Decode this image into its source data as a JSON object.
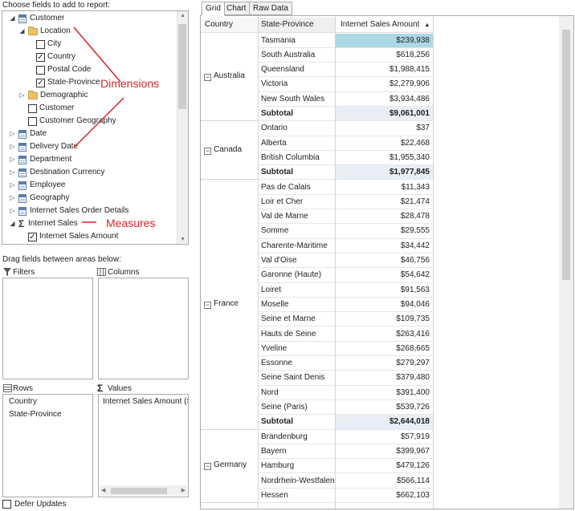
{
  "field_list": {
    "heading": "Choose fields to add to report:",
    "items": [
      {
        "label": "Customer",
        "kind": "table",
        "expander": "expanded",
        "level": 0
      },
      {
        "label": "Location",
        "kind": "folder",
        "expander": "expanded",
        "level": 1
      },
      {
        "label": "City",
        "kind": "field",
        "checked": false,
        "level": 2
      },
      {
        "label": "Country",
        "kind": "field",
        "checked": true,
        "level": 2
      },
      {
        "label": "Postal Code",
        "kind": "field",
        "checked": false,
        "level": 2
      },
      {
        "label": "State-Province",
        "kind": "field",
        "checked": true,
        "level": 2
      },
      {
        "label": "Demographic",
        "kind": "folder",
        "expander": "collapsed",
        "level": 1
      },
      {
        "label": "Customer",
        "kind": "field",
        "checked": false,
        "level": 1
      },
      {
        "label": "Customer Geography",
        "kind": "field",
        "checked": false,
        "level": 1
      },
      {
        "label": "Date",
        "kind": "table",
        "expander": "collapsed",
        "level": 0
      },
      {
        "label": "Delivery Date",
        "kind": "table",
        "expander": "collapsed",
        "level": 0
      },
      {
        "label": "Department",
        "kind": "table",
        "expander": "collapsed",
        "level": 0
      },
      {
        "label": "Destination Currency",
        "kind": "table",
        "expander": "collapsed",
        "level": 0
      },
      {
        "label": "Employee",
        "kind": "table",
        "expander": "collapsed",
        "level": 0
      },
      {
        "label": "Geography",
        "kind": "table",
        "expander": "collapsed",
        "level": 0
      },
      {
        "label": "Internet Sales Order Details",
        "kind": "table",
        "expander": "collapsed",
        "level": 0
      },
      {
        "label": "Internet Sales",
        "kind": "measure-group",
        "expander": "expanded",
        "level": 0
      },
      {
        "label": "Internet Sales Amount",
        "kind": "field",
        "checked": true,
        "level": 1
      }
    ]
  },
  "annotations": {
    "dimensions": "Dimensions",
    "measures": "Measures"
  },
  "areas": {
    "heading": "Drag fields between areas below:",
    "filters_label": "Filters",
    "columns_label": "Columns",
    "rows_label": "Rows",
    "values_label": "Values",
    "rows_items": [
      "Country",
      "State-Province"
    ],
    "values_items": [
      "Internet Sales Amount (S"
    ]
  },
  "defer_updates": {
    "label": "Defer Updates",
    "checked": false
  },
  "tabs": [
    {
      "label": "Grid",
      "active": true
    },
    {
      "label": "Chart",
      "active": false
    },
    {
      "label": "Raw Data",
      "active": false
    }
  ],
  "grid": {
    "headers": {
      "country": "Country",
      "state": "State-Province",
      "amount": "Internet Sales Amount",
      "sort_glyph": "▲"
    },
    "subtotal_label": "Subtotal",
    "groups": [
      {
        "country": "Australia",
        "rows": [
          {
            "state": "Tasmania",
            "amount": "$239,938",
            "highlight": true
          },
          {
            "state": "South Australia",
            "amount": "$618,256"
          },
          {
            "state": "Queensland",
            "amount": "$1,988,415"
          },
          {
            "state": "Victoria",
            "amount": "$2,279,906"
          },
          {
            "state": "New South Wales",
            "amount": "$3,934,486"
          }
        ],
        "subtotal": "$9,061,001"
      },
      {
        "country": "Canada",
        "rows": [
          {
            "state": "Ontario",
            "amount": "$37"
          },
          {
            "state": "Alberta",
            "amount": "$22,468"
          },
          {
            "state": "British Columbia",
            "amount": "$1,955,340"
          }
        ],
        "subtotal": "$1,977,845"
      },
      {
        "country": "France",
        "rows": [
          {
            "state": "Pas de Calais",
            "amount": "$11,343"
          },
          {
            "state": "Loir et Cher",
            "amount": "$21,474"
          },
          {
            "state": "Val de Marne",
            "amount": "$28,478"
          },
          {
            "state": "Somme",
            "amount": "$29,555"
          },
          {
            "state": "Charente-Maritime",
            "amount": "$34,442"
          },
          {
            "state": "Val d'Oise",
            "amount": "$46,756"
          },
          {
            "state": "Garonne (Haute)",
            "amount": "$54,642"
          },
          {
            "state": "Loiret",
            "amount": "$91,563"
          },
          {
            "state": "Moselle",
            "amount": "$94,046"
          },
          {
            "state": "Seine et Marne",
            "amount": "$109,735"
          },
          {
            "state": "Hauts de Seine",
            "amount": "$263,416"
          },
          {
            "state": "Yveline",
            "amount": "$268,665"
          },
          {
            "state": "Essonne",
            "amount": "$279,297"
          },
          {
            "state": "Seine Saint Denis",
            "amount": "$379,480"
          },
          {
            "state": "Nord",
            "amount": "$391,400"
          },
          {
            "state": "Seine (Paris)",
            "amount": "$539,726"
          }
        ],
        "subtotal": "$2,644,018"
      },
      {
        "country": "Germany",
        "rows": [
          {
            "state": "Brandenburg",
            "amount": "$57,919"
          },
          {
            "state": "Bayern",
            "amount": "$399,967"
          },
          {
            "state": "Hamburg",
            "amount": "$479,126"
          },
          {
            "state": "Nordrhein-Westfalen",
            "amount": "$566,114"
          },
          {
            "state": "Hessen",
            "amount": "$662,103"
          }
        ],
        "subtotal": null
      }
    ]
  },
  "icons": {
    "table": "table-icon",
    "folder": "folder-icon",
    "measure": "sigma-icon",
    "filter": "filter-icon",
    "columns": "columns-icon",
    "rows": "rows-icon",
    "values": "sigma-icon",
    "collapse": "minus-box-icon"
  },
  "colors": {
    "annotation": "#d6242a",
    "selected_cell": "#add8e6",
    "subtotal_bg": "#e9eef6"
  }
}
